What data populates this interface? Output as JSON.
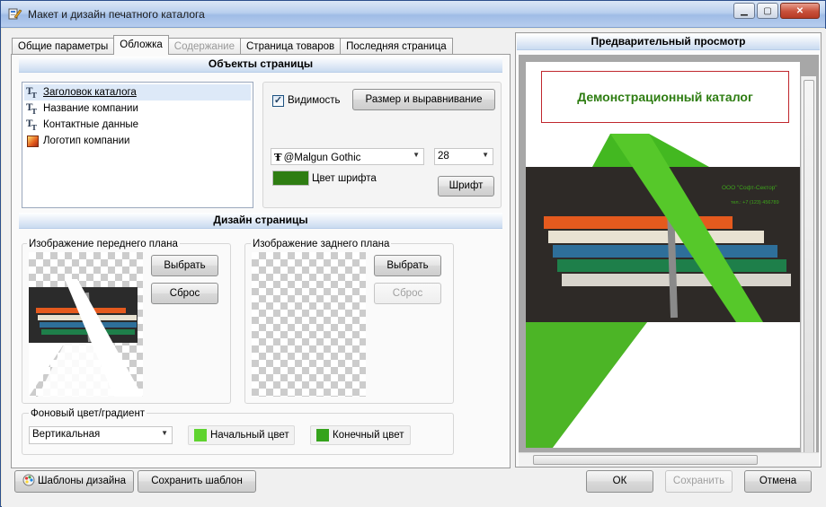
{
  "window": {
    "title": "Макет и дизайн печатного каталога",
    "minimize_glyph": "▁",
    "maximize_glyph": "▢",
    "close_glyph": "✕"
  },
  "tabs": [
    {
      "label": "Общие параметры"
    },
    {
      "label": "Обложка"
    },
    {
      "label": "Содержание"
    },
    {
      "label": "Страница товаров"
    },
    {
      "label": "Последняя страница"
    }
  ],
  "page_objects": {
    "heading": "Объекты страницы",
    "items": [
      {
        "label": "Заголовок каталога",
        "icon": "text-icon"
      },
      {
        "label": "Название компании",
        "icon": "text-icon"
      },
      {
        "label": "Контактные данные",
        "icon": "text-icon"
      },
      {
        "label": "Логотип компании",
        "icon": "image-icon"
      }
    ],
    "visibility_label": "Видимость",
    "visibility_checked": "✓",
    "size_align_button": "Размер и выравнивание",
    "font_name": "@Malgun Gothic",
    "font_size": "28",
    "font_color_label": "Цвет шрифта",
    "font_color": "#2e7d12",
    "font_button": "Шрифт"
  },
  "page_design": {
    "heading": "Дизайн страницы",
    "foreground": {
      "label": "Изображение переднего плана",
      "select_button": "Выбрать",
      "reset_button": "Сброс"
    },
    "background": {
      "label": "Изображение заднего плана",
      "select_button": "Выбрать",
      "reset_button": "Сброс"
    },
    "gradient": {
      "label": "Фоновый цвет/градиент",
      "direction": "Вертикальная",
      "start_color_label": "Начальный цвет",
      "start_color": "#5fd32f",
      "end_color_label": "Конечный цвет",
      "end_color": "#35a31c"
    }
  },
  "preview": {
    "heading": "Предварительный просмотр",
    "catalog_title": "Демонстрационный каталог",
    "company_name": "ООО \"Софт-Сектор\"",
    "contact_phone": "тел.: +7 (123) 456789"
  },
  "footer": {
    "templates_button": "Шаблоны дизайна",
    "save_template_button": "Сохранить шаблон",
    "ok_button": "ОК",
    "save_button": "Сохранить",
    "cancel_button": "Отмена"
  },
  "icons": {
    "text_glyph": "Tт"
  }
}
